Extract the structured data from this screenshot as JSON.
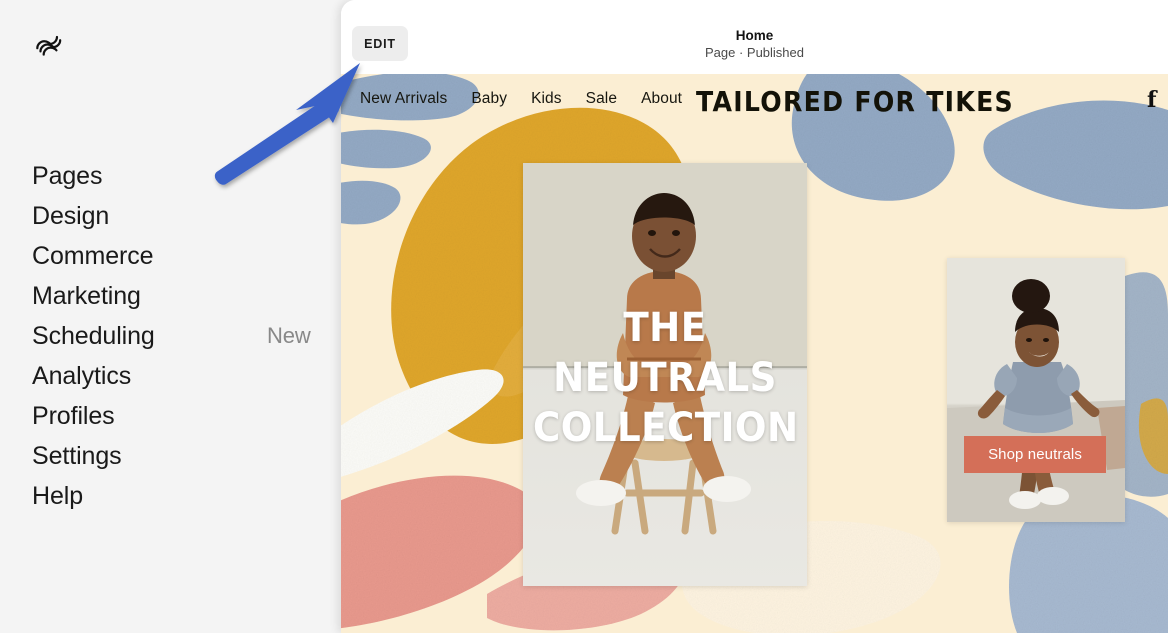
{
  "app": {
    "logo_icon": "squarespace-logo-icon"
  },
  "sidebar": {
    "items": [
      {
        "label": "Pages",
        "badge": ""
      },
      {
        "label": "Design",
        "badge": ""
      },
      {
        "label": "Commerce",
        "badge": ""
      },
      {
        "label": "Marketing",
        "badge": ""
      },
      {
        "label": "Scheduling",
        "badge": "New"
      },
      {
        "label": "Analytics",
        "badge": ""
      },
      {
        "label": "Profiles",
        "badge": ""
      },
      {
        "label": "Settings",
        "badge": ""
      },
      {
        "label": "Help",
        "badge": ""
      }
    ]
  },
  "topbar": {
    "edit_label": "EDIT",
    "page_title": "Home",
    "page_status": "Page · Published"
  },
  "site": {
    "nav_links": [
      {
        "label": "New Arrivals"
      },
      {
        "label": "Baby"
      },
      {
        "label": "Kids"
      },
      {
        "label": "Sale"
      },
      {
        "label": "About"
      }
    ],
    "title": "TAILORED FOR TIKES",
    "social_icon_glyph": "f",
    "hero": {
      "line1": "THE",
      "line2": "NEUTRALS",
      "line3": "COLLECTION"
    },
    "promo": {
      "button_label": "Shop neutrals"
    }
  },
  "colors": {
    "sidebar_bg": "#f4f4f4",
    "panel_bg": "#ffffff",
    "edit_button_bg": "#ededed",
    "canvas_cream": "#fbeed3",
    "paint_gold": "#dfa62c",
    "paint_blue": "#93a9c4",
    "paint_salmon": "#e8998d",
    "paint_white": "#fbfbf7",
    "shop_button": "#d46f58",
    "annotation_arrow": "#3b62c8",
    "text_primary": "#1a1a1a",
    "text_muted": "#888888"
  },
  "annotation": {
    "arrow_icon": "pointer-arrow-icon",
    "points_to": "EDIT"
  }
}
